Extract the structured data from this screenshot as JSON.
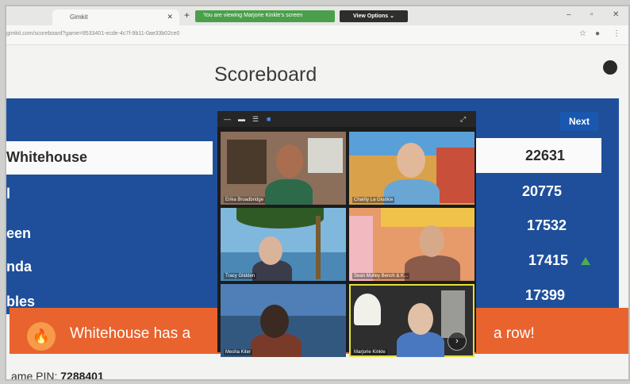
{
  "browser": {
    "tab_title": "Gimkit",
    "share_notice": "You are viewing Marjorie Kinkle's screen",
    "view_options": "View Options ⌄",
    "url": "gimkit.com/scoreboard?game=9533401-ecde-4c7f-9b11-0ae33b02ce0"
  },
  "page": {
    "title": "Scoreboard",
    "next_label": "Next",
    "game_pin_label": "ame PIN: ",
    "game_pin_value": "7288401"
  },
  "leaderboard": [
    {
      "name": "Whitehouse",
      "score": "22631"
    },
    {
      "name": "l",
      "score": "20775"
    },
    {
      "name": "een",
      "score": "17532"
    },
    {
      "name": "nda",
      "score": "17415"
    },
    {
      "name": "bles",
      "score": "17399"
    }
  ],
  "streak_banner": {
    "left_text": "Whitehouse has a",
    "right_text": "a row!"
  },
  "zoom": {
    "participants": [
      {
        "name": "Erika Broadbridge"
      },
      {
        "name": "Charity La Giudice"
      },
      {
        "name": "Tracy Glidden"
      },
      {
        "name": "Sean Mulley Bench & K..."
      },
      {
        "name": "Mesha Kiter"
      },
      {
        "name": "Marjorie Kinkle"
      }
    ]
  },
  "colors": {
    "scoreboard_blue": "#1f4f9a",
    "streak_orange": "#e8632e",
    "share_green": "#4aa04a"
  }
}
